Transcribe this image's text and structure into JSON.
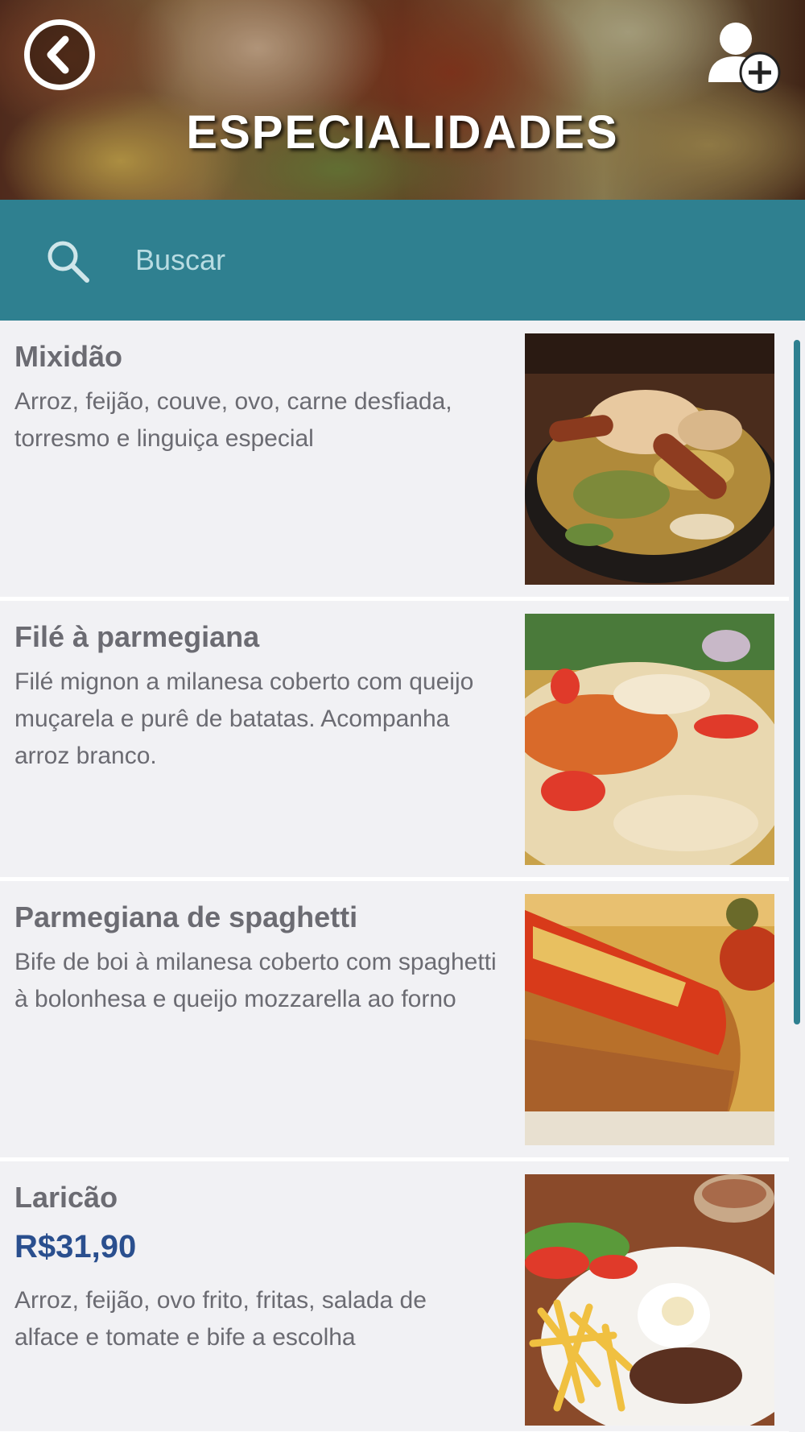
{
  "header": {
    "title": "ESPECIALIDADES",
    "back_icon": "chevron-left-circle-icon",
    "add_user_icon": "add-user-icon"
  },
  "search": {
    "placeholder": "Buscar",
    "icon": "search-icon",
    "bar_color": "#2f8090"
  },
  "items": [
    {
      "title": "Mixidão",
      "description": "Arroz, feijão, couve, ovo, carne desfiada, torresmo e linguiça especial",
      "photo": "mixidao-photo"
    },
    {
      "title": "Filé à parmegiana",
      "description": "Filé mignon a milanesa coberto com queijo muçarela e purê de batatas. Acompanha arroz branco.",
      "photo": "file-parmegiana-photo"
    },
    {
      "title": "Parmegiana de spaghetti",
      "description": "Bife de boi à milanesa coberto com spaghetti à bolonhesa e queijo mozzarella ao forno",
      "photo": "parmegiana-spaghetti-photo"
    },
    {
      "title": "Laricão",
      "price": "R$31,90",
      "description": "Arroz, feijão, ovo frito, fritas, salada de alface e tomate e bife a escolha",
      "photo": "laricao-photo"
    }
  ],
  "colors": {
    "accent": "#2f8090",
    "price": "#2a4f8e",
    "text": "#6b6b72",
    "item_background": "#f1f1f4"
  }
}
